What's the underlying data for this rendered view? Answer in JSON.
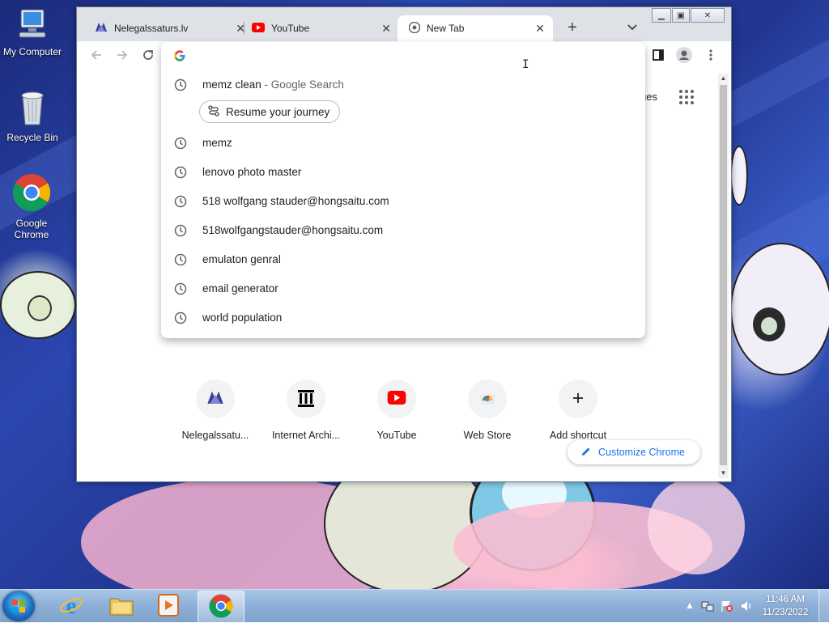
{
  "desktop": {
    "icons": [
      {
        "label": "My Computer"
      },
      {
        "label": "Recycle Bin"
      },
      {
        "label": "Google Chrome"
      }
    ]
  },
  "browser": {
    "tabs": [
      {
        "title": "Nelegalssaturs.lv",
        "icon": "nelegalssaturs-favicon"
      },
      {
        "title": "YouTube",
        "icon": "youtube-icon"
      },
      {
        "title": "New Tab",
        "icon": "chrome-icon"
      }
    ],
    "new_tab_symbol": "+",
    "partial_header_text": "ges",
    "omnibox": {
      "value": "",
      "suggestions": [
        {
          "main": "memz clean",
          "suffix": " - Google Search"
        },
        {
          "main": "memz"
        },
        {
          "main": "lenovo photo master"
        },
        {
          "main": "518 wolfgang stauder@hongsaitu.com"
        },
        {
          "main": "518wolfgangstauder@hongsaitu.com"
        },
        {
          "main": "emulaton genral"
        },
        {
          "main": "email generator"
        },
        {
          "main": "world population"
        }
      ],
      "journey_label": "Resume your journey"
    },
    "shortcuts": [
      {
        "label": "Nelegalssatu...",
        "icon": "nelegalssaturs-favicon"
      },
      {
        "label": "Internet Archi...",
        "icon": "internet-archive-icon"
      },
      {
        "label": "YouTube",
        "icon": "youtube-icon"
      },
      {
        "label": "Web Store",
        "icon": "web-store-icon"
      },
      {
        "label": "Add shortcut",
        "icon": "plus-icon"
      }
    ],
    "customize_label": "Customize Chrome"
  },
  "taskbar": {
    "time": "11:46 AM",
    "date": "11/23/2022",
    "apps": [
      "internet-explorer",
      "windows-explorer",
      "media-player",
      "google-chrome"
    ]
  },
  "colors": {
    "accent": "#1a73e8",
    "youtube_red": "#ff0000"
  }
}
